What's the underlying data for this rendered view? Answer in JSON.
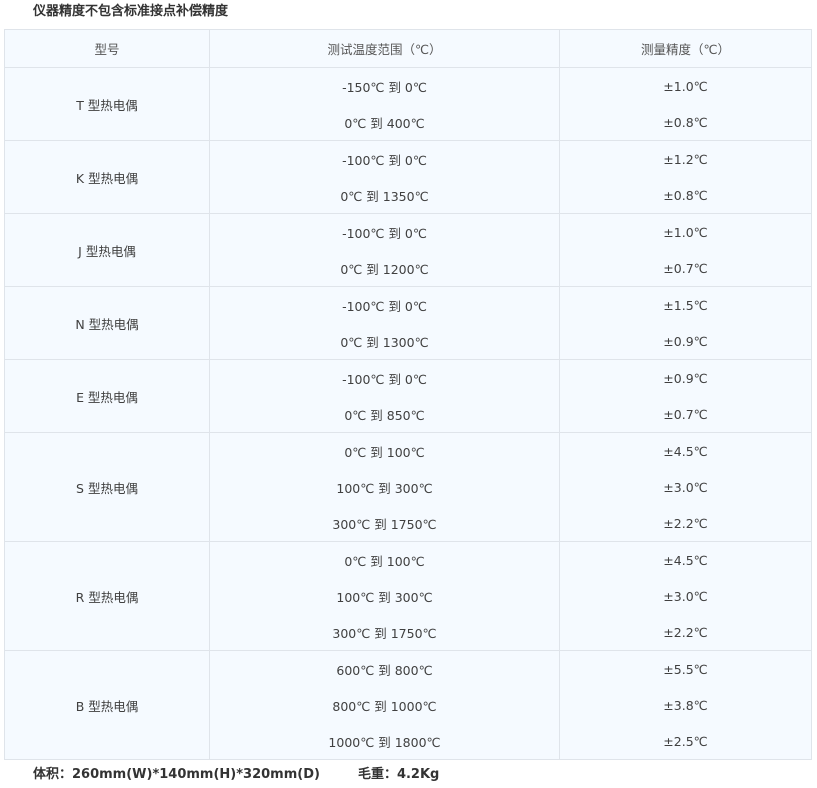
{
  "title": "仪器精度不包含标准接点补偿精度",
  "table": {
    "headers": [
      "型号",
      "测试温度范围（℃）",
      "测量精度（℃）"
    ],
    "groups": [
      {
        "type": "T 型热电偶",
        "rows": [
          {
            "range": "-150℃ 到 0℃",
            "accuracy": "±1.0℃"
          },
          {
            "range": "0℃ 到 400℃",
            "accuracy": "±0.8℃"
          }
        ]
      },
      {
        "type": "K 型热电偶",
        "rows": [
          {
            "range": "-100℃ 到 0℃",
            "accuracy": "±1.2℃"
          },
          {
            "range": "0℃ 到 1350℃",
            "accuracy": "±0.8℃"
          }
        ]
      },
      {
        "type": "J 型热电偶",
        "rows": [
          {
            "range": "-100℃ 到 0℃",
            "accuracy": "±1.0℃"
          },
          {
            "range": "0℃ 到 1200℃",
            "accuracy": "±0.7℃"
          }
        ]
      },
      {
        "type": "N 型热电偶",
        "rows": [
          {
            "range": "-100℃ 到 0℃",
            "accuracy": "±1.5℃"
          },
          {
            "range": "0℃ 到 1300℃",
            "accuracy": "±0.9℃"
          }
        ]
      },
      {
        "type": "E 型热电偶",
        "rows": [
          {
            "range": "-100℃ 到 0℃",
            "accuracy": "±0.9℃"
          },
          {
            "range": "0℃ 到 850℃",
            "accuracy": "±0.7℃"
          }
        ]
      },
      {
        "type": "S 型热电偶",
        "rows": [
          {
            "range": "0℃ 到 100℃",
            "accuracy": "±4.5℃"
          },
          {
            "range": "100℃ 到 300℃",
            "accuracy": "±3.0℃"
          },
          {
            "range": "300℃ 到 1750℃",
            "accuracy": "±2.2℃"
          }
        ]
      },
      {
        "type": "R 型热电偶",
        "rows": [
          {
            "range": "0℃ 到 100℃",
            "accuracy": "±4.5℃"
          },
          {
            "range": "100℃ 到 300℃",
            "accuracy": "±3.0℃"
          },
          {
            "range": "300℃ 到 1750℃",
            "accuracy": "±2.2℃"
          }
        ]
      },
      {
        "type": "B 型热电偶",
        "rows": [
          {
            "range": "600℃ 到 800℃",
            "accuracy": "±5.5℃"
          },
          {
            "range": "800℃ 到 1000℃",
            "accuracy": "±3.8℃"
          },
          {
            "range": "1000℃ 到 1800℃",
            "accuracy": "±2.5℃"
          }
        ]
      }
    ]
  },
  "footer": {
    "volume": "体积：260mm(W)*140mm(H)*320mm(D)",
    "weight": "毛重：4.2Kg"
  }
}
